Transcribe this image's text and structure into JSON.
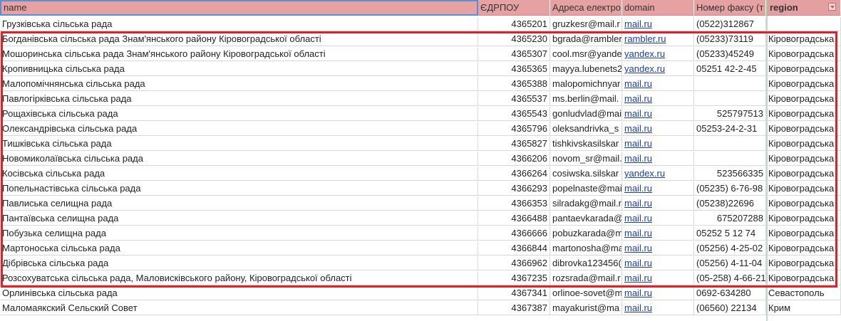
{
  "headers": [
    "name",
    "ЄДРПОУ",
    "Адреса електро",
    "domain",
    "Номер факсу (т",
    "region"
  ],
  "rows": [
    {
      "name": "Грузківська сільська рада",
      "edrpou": "4365201",
      "email": "gruzkesr@mail.r",
      "domain": "mail.ru",
      "fax": "(0522)312867",
      "region": ""
    },
    {
      "name": "Богданівська сільська рада Знам'янського району Кіровоградської області",
      "edrpou": "4365230",
      "email": "bgrada@rambler",
      "domain": "rambler.ru",
      "fax": "(05233)73119",
      "region": "Кіровоградська"
    },
    {
      "name": "Мошоринська  сільська  рада  Знам'янського  району  Кіровоградської  області",
      "edrpou": "4365307",
      "email": "cool.msr@yande",
      "domain": "yandex.ru",
      "fax": "(05233)45249",
      "region": "Кіровоградська"
    },
    {
      "name": "Кропивницька сільська рада",
      "edrpou": "4365365",
      "email": "mayya.lubenets2",
      "domain": "yandex.ru",
      "fax": "05251 42-2-45",
      "region": "Кіровоградська"
    },
    {
      "name": "Малопомічнянська сільська рада",
      "edrpou": "4365388",
      "email": "malopomichnyar",
      "domain": "mail.ru",
      "fax": "",
      "region": "Кіровоградська"
    },
    {
      "name": "Павлогірківська сільська рада",
      "edrpou": "4365537",
      "email": "ms.berlin@mail.",
      "domain": "mail.ru",
      "fax": "",
      "region": "Кіровоградська"
    },
    {
      "name": "Рощахівська сільська рада",
      "edrpou": "4365543",
      "email": "gonludvlad@mai",
      "domain": "mail.ru",
      "fax": "525797513",
      "region": "Кіровоградська"
    },
    {
      "name": "Олександрівська сільська рада",
      "edrpou": "4365796",
      "email": "oleksandrivka_s",
      "domain": "mail.ru",
      "fax": "05253-24-2-31",
      "region": "Кіровоградська"
    },
    {
      "name": "Тишківська сільська рада",
      "edrpou": "4365827",
      "email": "tishkivskasilskar",
      "domain": "mail.ru",
      "fax": "",
      "region": "Кіровоградська"
    },
    {
      "name": "Новомиколаївська сільська рада",
      "edrpou": "4366206",
      "email": "novom_sr@mail.",
      "domain": "mail.ru",
      "fax": "",
      "region": "Кіровоградська"
    },
    {
      "name": "Косівська сільська рада",
      "edrpou": "4366264",
      "email": "cosiwska.silskar",
      "domain": "yandex.ru",
      "fax": "523566335",
      "region": "Кіровоградська"
    },
    {
      "name": "Попельнастівська сільська рада",
      "edrpou": "4366293",
      "email": "popelnaste@mai",
      "domain": "mail.ru",
      "fax": "(05235) 6-76-98",
      "region": "Кіровоградська"
    },
    {
      "name": "Павлиська селищна рада",
      "edrpou": "4366353",
      "email": "silradakg@mail.r",
      "domain": "mail.ru",
      "fax": "(05238)22696",
      "region": "Кіровоградська"
    },
    {
      "name": "Пантаївська селищна рада",
      "edrpou": "4366488",
      "email": "pantaevkarada@",
      "domain": "mail.ru",
      "fax": "675207288",
      "region": "Кіровоградська"
    },
    {
      "name": "Побузька селищна рада",
      "edrpou": "4366666",
      "email": "pobuzkarada@m",
      "domain": "mail.ru",
      "fax": "05252 5 12 74",
      "region": "Кіровоградська"
    },
    {
      "name": "Мартоноська сільська рада",
      "edrpou": "4366844",
      "email": "martonosha@ma",
      "domain": "mail.ru",
      "fax": "(05256) 4-25-02",
      "region": "Кіровоградська"
    },
    {
      "name": "Дібрівська сільська рада",
      "edrpou": "4366962",
      "email": "dibrovka123456(",
      "domain": "mail.ru",
      "fax": "(05256) 4-11-04",
      "region": "Кіровоградська"
    },
    {
      "name": "Розсохуватська сільська рада, Маловисківського району, Кіровоградської області",
      "edrpou": "4367235",
      "email": "rozsrada@mail.r",
      "domain": "mail.ru",
      "fax": "(05-258) 4-66-21",
      "region": "Кіровоградська"
    },
    {
      "name": "Орлинівська сільська рада",
      "edrpou": "4367341",
      "email": "orlinoe-sovet@m",
      "domain": "mail.ru",
      "fax": "0692-634280",
      "region": "Севастополь"
    },
    {
      "name": "Маломаякский Сельский Совет",
      "edrpou": "4367387",
      "email": "mayakurist@ma",
      "domain": "mail.ru",
      "fax": "(06560) 22134",
      "region": "Крим"
    }
  ],
  "colors": {
    "header_bg": "#e6a2a2",
    "highlight": "#e0202a",
    "link": "#1c3ea8",
    "selection": "#5b8ed9"
  }
}
